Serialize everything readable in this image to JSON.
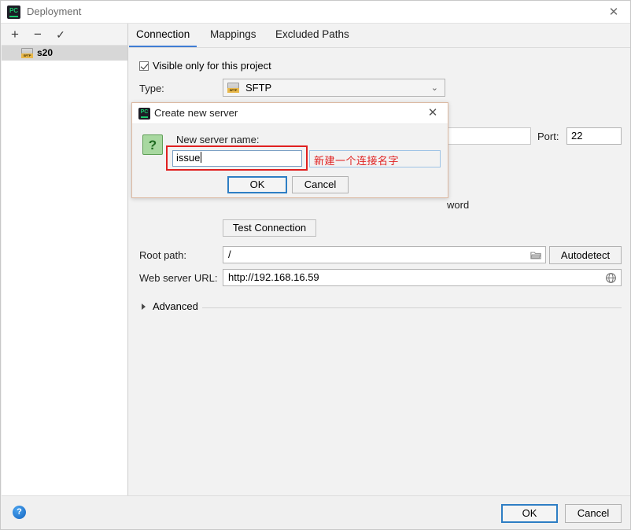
{
  "window": {
    "title": "Deployment",
    "app_icon": "pycharm-logo-icon",
    "close_icon": "close-icon",
    "close_glyph": "✕"
  },
  "sidebar": {
    "toolbar": {
      "add_label": "+",
      "remove_label": "−",
      "check_label": "✓"
    },
    "items": [
      {
        "label": "s20",
        "icon": "sftp-server-icon",
        "selected": true
      }
    ]
  },
  "main": {
    "tabs": [
      {
        "label": "Connection",
        "active": true
      },
      {
        "label": "Mappings",
        "active": false
      },
      {
        "label": "Excluded Paths",
        "active": false
      }
    ],
    "visible_only_checkbox": {
      "label": "Visible only for this project",
      "checked": true
    },
    "type": {
      "label": "Type:",
      "value": "SFTP",
      "icon": "sftp-icon",
      "chevron": "⌄"
    },
    "host_field": {
      "value": ""
    },
    "port": {
      "label": "Port:",
      "value": "22"
    },
    "password_fragment": "word",
    "test_connection_label": "Test Connection",
    "root_path": {
      "label": "Root path:",
      "value": "/",
      "browse_icon": "folder-icon"
    },
    "autodetect_label": "Autodetect",
    "web_server_url": {
      "label": "Web server URL:",
      "value": "http://192.168.16.59",
      "open_icon": "globe-icon"
    },
    "advanced": {
      "label": "Advanced",
      "expanded": false,
      "arrow_icon": "chevron-right-icon"
    }
  },
  "footer": {
    "help_icon": "help-icon",
    "help_glyph": "?",
    "ok_label": "OK",
    "cancel_label": "Cancel"
  },
  "dialog": {
    "title": "Create new server",
    "app_icon": "pycharm-logo-icon",
    "close_icon": "close-icon",
    "close_glyph": "✕",
    "question_icon": "question-mark-icon",
    "question_glyph": "?",
    "field_label": "New server name:",
    "name_value": "issue",
    "ok_label": "OK",
    "cancel_label": "Cancel"
  },
  "annotation": {
    "text": "新建一个连接名字",
    "color": "#e02020"
  },
  "colors": {
    "accent_blue": "#2e7ec4",
    "tab_underline": "#3f7dd4",
    "annotation_red": "#e02020",
    "dialog_border": "#dcb9a2",
    "selection_gray": "#d7d7d7",
    "green_icon": "#a8d8a0"
  }
}
